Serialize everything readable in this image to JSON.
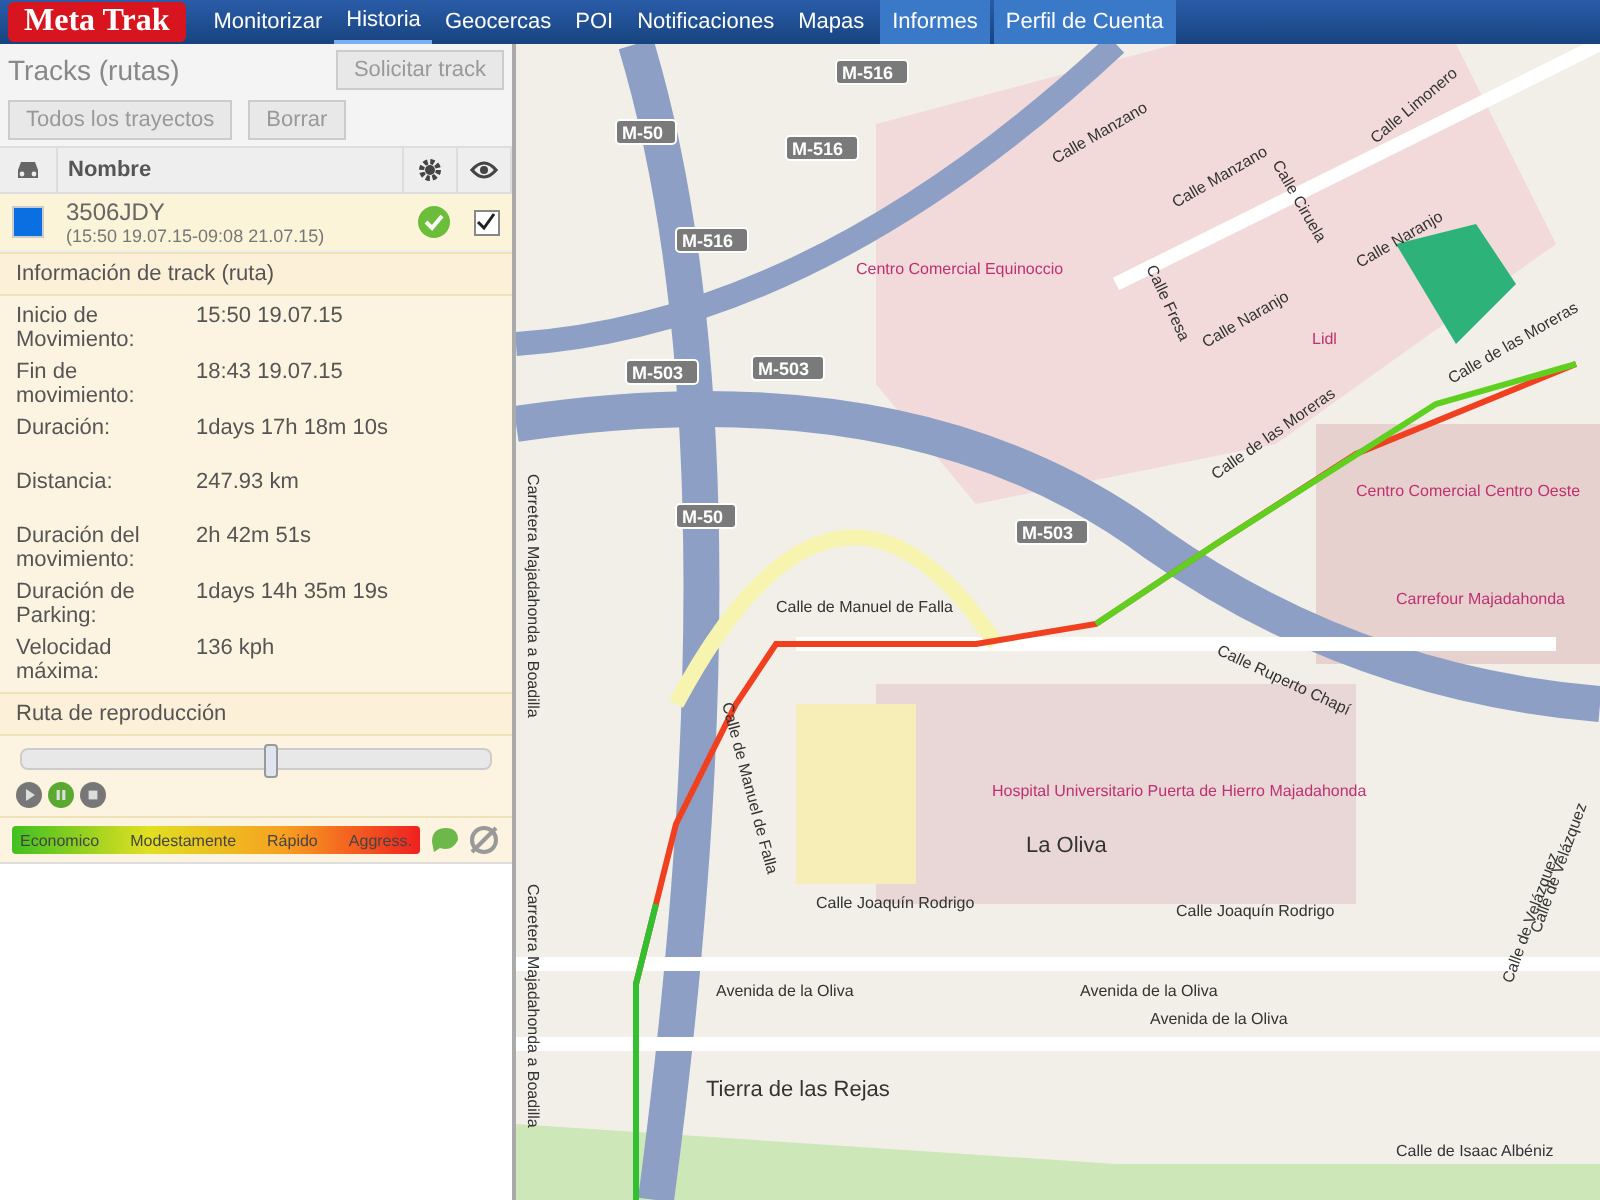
{
  "brand": "Meta Trak",
  "nav": [
    {
      "label": "Monitorizar",
      "selected": false,
      "kind": "main"
    },
    {
      "label": "Historia",
      "selected": true,
      "kind": "main"
    },
    {
      "label": "Geocercas",
      "selected": false,
      "kind": "main"
    },
    {
      "label": "POI",
      "selected": false,
      "kind": "main"
    },
    {
      "label": "Notificaciones",
      "selected": false,
      "kind": "main"
    },
    {
      "label": "Mapas",
      "selected": false,
      "kind": "main"
    },
    {
      "label": "Informes",
      "selected": false,
      "kind": "account"
    },
    {
      "label": "Perfil de Cuenta",
      "selected": false,
      "kind": "account"
    }
  ],
  "panel": {
    "title": "Tracks (rutas)",
    "request_button": "Solicitar track",
    "buttons": [
      "Todos los trayectos",
      "Borrar"
    ],
    "table": {
      "name_column": "Nombre",
      "rows": [
        {
          "name": "3506JDY",
          "period": "(15:50 19.07.15-09:08 21.07.15)",
          "color": "#0a6fe0",
          "status_ok": true,
          "visible": true
        }
      ]
    },
    "info_title": "Información de track (ruta)",
    "info": [
      {
        "label": "Inicio de Movimiento:",
        "value": "15:50 19.07.15"
      },
      {
        "label": "Fin de movimiento:",
        "value": "18:43 19.07.15"
      },
      {
        "label": "Duración:",
        "value": "1days 17h 18m 10s"
      },
      {
        "label": "Distancia:",
        "value": "247.93 km"
      },
      {
        "label": "Duración del movimiento:",
        "value": "2h 42m 51s"
      },
      {
        "label": "Duración de Parking:",
        "value": "1days 14h 35m 19s"
      },
      {
        "label": "Velocidad máxima:",
        "value": "136 kph"
      }
    ],
    "playback_title": "Ruta de reproducción",
    "playback": {
      "level": 0.53,
      "playing": true
    },
    "speed_legend": [
      "Economico",
      "Modestamente",
      "Rápido",
      "Aggress."
    ]
  },
  "map_labels": [
    "M-516",
    "Calle Limonero",
    "Calle Manzano",
    "M-50",
    "M-516",
    "Calle Manzano",
    "Calle Ciruela",
    "M-516",
    "Calle Fresa",
    "Centro Comercial Equinoccio",
    "Calle Naranjo",
    "Calle Naranjo",
    "Lidl",
    "M-503",
    "M-503",
    "Calle de las Moreras",
    "Calle de las Moreras",
    "Centro Comercial Centro Oeste",
    "Carretera Majadahonda a Boadilla",
    "M-50",
    "M-503",
    "Calle de Manuel de Falla",
    "Carrefour Majadahonda",
    "Calle Ruperto Chapí",
    "Calle de Manuel de Falla",
    "Hospital Universitario Puerta de Hierro Majadahonda",
    "La Oliva",
    "Calle Joaquín Rodrigo",
    "Calle Joaquín Rodrigo",
    "Calle de Velázquez",
    "Calle de Velázquez",
    "Carretera Majadahonda a Boadilla",
    "Avenida de la Oliva",
    "Avenida de la Oliva",
    "Avenida de la Oliva",
    "Tierra de las Rejas",
    "Calle de Isaac Albéniz"
  ]
}
